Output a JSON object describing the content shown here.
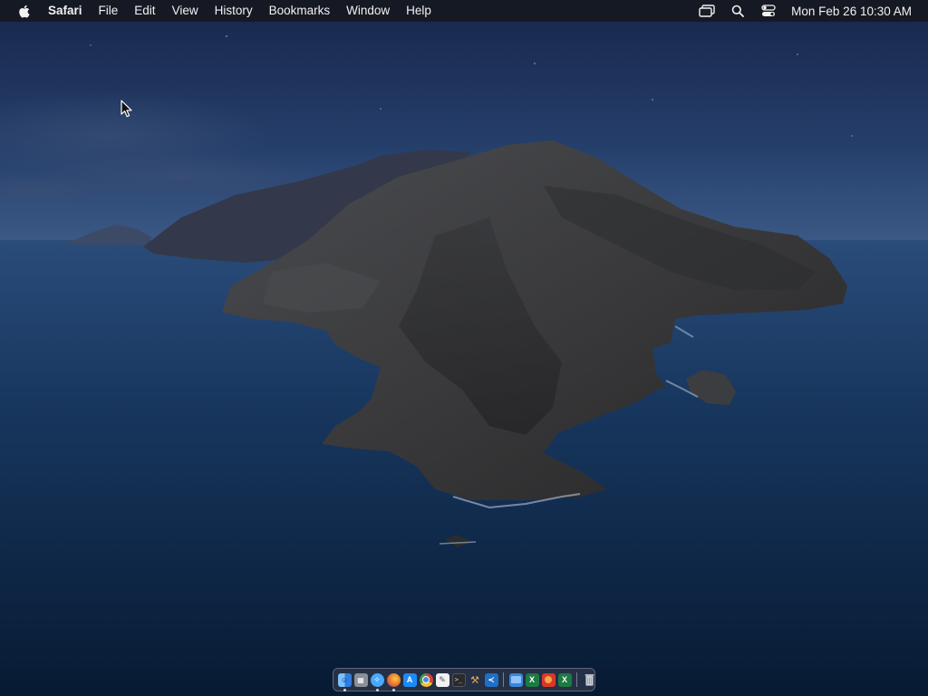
{
  "menubar": {
    "app_name": "Safari",
    "items": [
      "File",
      "Edit",
      "View",
      "History",
      "Bookmarks",
      "Window",
      "Help"
    ],
    "icons": [
      "apple-logo-icon",
      "screen-mirroring-icon",
      "search-icon",
      "control-center-icon"
    ],
    "clock": "Mon Feb 26  10:30 AM"
  },
  "dock": {
    "apps": [
      {
        "name": "finder",
        "icon": "finder-icon",
        "color": "#3d8ff5",
        "running": true
      },
      {
        "name": "launchpad",
        "icon": "launchpad-icon",
        "color": "#8a8f99",
        "running": false
      },
      {
        "name": "safari",
        "icon": "safari-icon",
        "color": "#4aa8ff",
        "running": true
      },
      {
        "name": "firefox",
        "icon": "firefox-icon",
        "color": "#e8702a",
        "running": true
      },
      {
        "name": "app-store",
        "icon": "app-store-icon",
        "color": "#1c8bf5",
        "running": false
      },
      {
        "name": "chrome",
        "icon": "chrome-icon",
        "color": "#9a9a9a",
        "running": false
      },
      {
        "name": "textedit",
        "icon": "textedit-icon",
        "color": "#f2f2f2",
        "running": false
      },
      {
        "name": "terminal",
        "icon": "terminal-icon",
        "color": "#2a2a2a",
        "running": false
      },
      {
        "name": "xcode-instruments",
        "icon": "hammer-icon",
        "color": "#c08a3a",
        "running": false
      },
      {
        "name": "vscode",
        "icon": "vscode-icon",
        "color": "#1f6fc4",
        "running": false
      },
      {
        "name": "finder-folder",
        "icon": "folder-icon",
        "color": "#3b86d6",
        "running": false
      },
      {
        "name": "excel",
        "icon": "excel-icon",
        "color": "#1d7a42",
        "running": false
      },
      {
        "name": "photo-booth",
        "icon": "photo-booth-icon",
        "color": "#d8382c",
        "running": false
      },
      {
        "name": "excel-2",
        "icon": "excel-icon",
        "color": "#1d7a42",
        "running": false
      }
    ],
    "trash": {
      "name": "trash",
      "icon": "trash-icon",
      "color": "#9aa0a8"
    }
  },
  "wallpaper": {
    "name": "catalina-island-wallpaper",
    "sky_color": "#1e3359",
    "sea_color": "#0e2443",
    "rock_color": "#3a3a3c"
  }
}
